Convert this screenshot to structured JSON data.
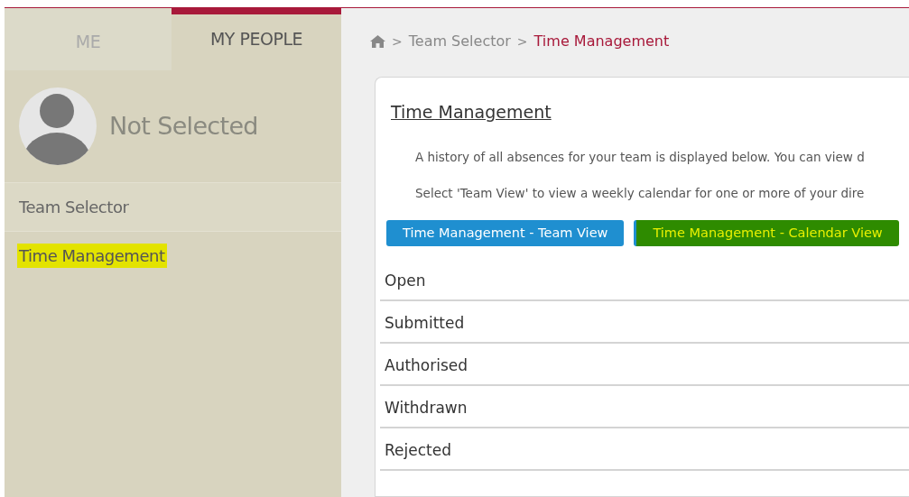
{
  "tabs": [
    {
      "label": "ME",
      "selected": false
    },
    {
      "label": "MY PEOPLE",
      "selected": true
    }
  ],
  "profile": {
    "name": "Not Selected"
  },
  "sidebar": {
    "items": [
      {
        "label": "Team Selector",
        "highlighted": false
      },
      {
        "label": "Time Management",
        "highlighted": true
      }
    ]
  },
  "breadcrumb": {
    "separator": ">",
    "items": [
      {
        "label": "Team Selector",
        "current": false
      },
      {
        "label": "Time Management",
        "current": true
      }
    ]
  },
  "card": {
    "title": "Time Management",
    "paragraphs": [
      "A history of all absences for your team is displayed below. You can view d",
      "Select 'Team View' to view a weekly calendar for one or more of your dire"
    ],
    "buttons": [
      {
        "label": "Time Management - Team View",
        "highlighted": false
      },
      {
        "label": "Time Management - Calendar View",
        "highlighted": true
      }
    ],
    "sections": [
      "Open",
      "Submitted",
      "Authorised",
      "Withdrawn",
      "Rejected"
    ]
  }
}
